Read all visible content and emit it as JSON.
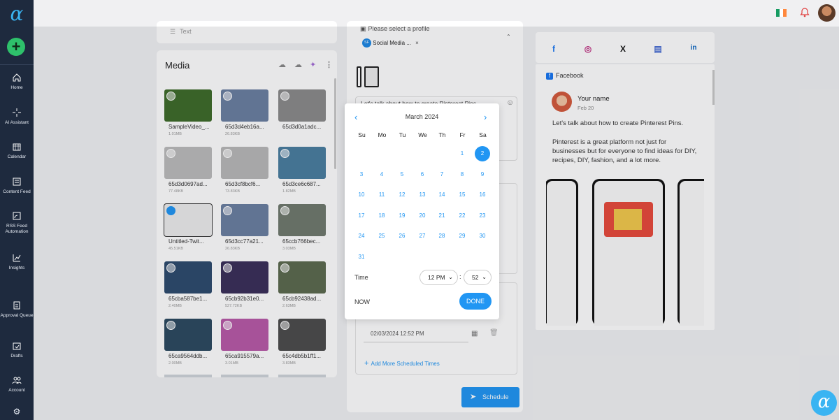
{
  "sidebar": {
    "items": [
      {
        "label": "Home",
        "icon": "home-icon"
      },
      {
        "label": "AI Assistant",
        "icon": "sparkle-icon"
      },
      {
        "label": "Calendar",
        "icon": "calendar-icon"
      },
      {
        "label": "Content Feed",
        "icon": "feed-icon"
      },
      {
        "label": "RSS Feed Automation",
        "icon": "rss-icon"
      },
      {
        "label": "Insights",
        "icon": "chart-icon"
      },
      {
        "label": "Approval Queue",
        "icon": "clipboard-icon"
      },
      {
        "label": "Drafts",
        "icon": "drafts-icon"
      },
      {
        "label": "Account",
        "icon": "users-icon"
      }
    ]
  },
  "left": {
    "text_placeholder": "Text",
    "media_title": "Media"
  },
  "media": [
    {
      "name": "SampleVideo_...",
      "size": "1.01MB",
      "color": "#3e6b2a"
    },
    {
      "name": "65d3d4eb16a...",
      "size": "26.83KB",
      "color": "#6a7fa1"
    },
    {
      "name": "65d3d0a1adc...",
      "size": "",
      "color": "#8b8b8b"
    },
    {
      "name": "65d3d0697ad...",
      "size": "77.48KB",
      "color": "#bcbcbc"
    },
    {
      "name": "65d3cf8bcf6...",
      "size": "73.83KB",
      "color": "#b8b8b8"
    },
    {
      "name": "65d3ce6c687...",
      "size": "1.82MB",
      "color": "#4a7ea0"
    },
    {
      "name": "Untitled-Twit...",
      "size": "45.51KB",
      "color": "#ececec"
    },
    {
      "name": "65d3cc77a21...",
      "size": "26.83KB",
      "color": "#6a7fa1"
    },
    {
      "name": "65ccb766bec...",
      "size": "3.03MB",
      "color": "#707a6e"
    },
    {
      "name": "65cba587be1...",
      "size": "2.40MB",
      "color": "#2d4b6e"
    },
    {
      "name": "65cb92b31e0...",
      "size": "527.72KB",
      "color": "#3a2f5a"
    },
    {
      "name": "65cb92438ad...",
      "size": "2.63MB",
      "color": "#5c6a4f"
    },
    {
      "name": "65ca9564ddb...",
      "size": "2.00MB",
      "color": "#2c4a60"
    },
    {
      "name": "65ca915579a...",
      "size": "3.01MB",
      "color": "#b85aa8"
    },
    {
      "name": "65c4db5b1ff1...",
      "size": "3.83MB",
      "color": "#4c4c4c"
    }
  ],
  "composer": {
    "profile_label": "Please select a profile",
    "profile_chip": "Social Media ...",
    "profile_initials": "SF",
    "post_text": "Let's talk about how to create Pinterest Pins.",
    "scheduled_value": "02/03/2024 12:52 PM",
    "add_more": "Add More Scheduled Times",
    "schedule_button": "Schedule"
  },
  "calendar": {
    "month": "March 2024",
    "dow": [
      "Su",
      "Mo",
      "Tu",
      "We",
      "Th",
      "Fr",
      "Sa"
    ],
    "weeks": [
      [
        "",
        "",
        "",
        "",
        "",
        "1",
        "2"
      ],
      [
        "3",
        "4",
        "5",
        "6",
        "7",
        "8",
        "9"
      ],
      [
        "10",
        "11",
        "12",
        "13",
        "14",
        "15",
        "16"
      ],
      [
        "17",
        "18",
        "19",
        "20",
        "21",
        "22",
        "23"
      ],
      [
        "24",
        "25",
        "26",
        "27",
        "28",
        "29",
        "30"
      ],
      [
        "31",
        "",
        "",
        "",
        "",
        "",
        ""
      ]
    ],
    "selected": "2",
    "time_label": "Time",
    "hour": "12 PM",
    "minute": "52",
    "now_label": "NOW",
    "done_label": "DONE"
  },
  "preview": {
    "tabs": [
      "facebook",
      "instagram",
      "x",
      "google-business",
      "linkedin"
    ],
    "network": "Facebook",
    "name": "Your name",
    "date": "Feb 20",
    "line1": "Let's talk about how to create Pinterest Pins.",
    "line2": "Pinterest is a great platform not just for",
    "line3": "businesses but for everyone to find ideas for DIY,",
    "line4": "recipes, DIY, fashion, and a lot more."
  },
  "colors": {
    "accent": "#2196f3",
    "sidebar": "#1e2a3e",
    "brand": "#3ab4f2",
    "add": "#2ec16b"
  }
}
